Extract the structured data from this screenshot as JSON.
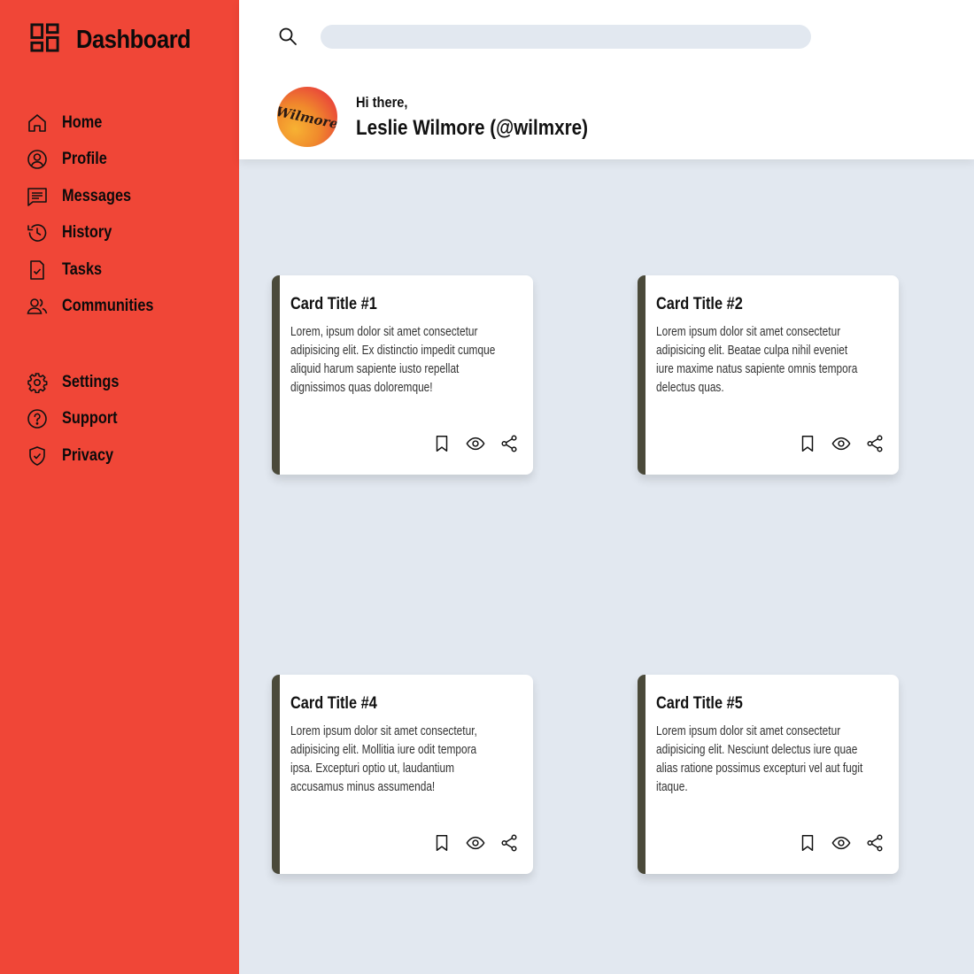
{
  "sidebar": {
    "brand_title": "Dashboard",
    "primary_items": [
      {
        "label": "Home",
        "icon": "home-icon"
      },
      {
        "label": "Profile",
        "icon": "user-circle-icon"
      },
      {
        "label": "Messages",
        "icon": "message-icon"
      },
      {
        "label": "History",
        "icon": "history-icon"
      },
      {
        "label": "Tasks",
        "icon": "task-icon"
      },
      {
        "label": "Communities",
        "icon": "users-icon"
      }
    ],
    "secondary_items": [
      {
        "label": "Settings",
        "icon": "gear-icon"
      },
      {
        "label": "Support",
        "icon": "help-icon"
      },
      {
        "label": "Privacy",
        "icon": "shield-icon"
      }
    ]
  },
  "header": {
    "search_placeholder": "",
    "greeting": "Hi there,",
    "user_name": "Leslie Wilmore (@wilmxre)",
    "avatar_text": "Wilmore"
  },
  "cards": [
    {
      "title": "Card Title #1",
      "text": "Lorem, ipsum dolor sit amet consectetur adipisicing elit. Ex distinctio impedit cumque aliquid harum sapiente iusto repellat dignissimos quas doloremque!"
    },
    {
      "title": "Card Title #2",
      "text": "Lorem ipsum dolor sit amet consectetur adipisicing elit. Beatae culpa nihil eveniet iure maxime natus sapiente omnis tempora delectus quas."
    },
    {
      "title": "Card Title #4",
      "text": "Lorem ipsum dolor sit amet consectetur, adipisicing elit. Mollitia iure odit tempora ipsa. Excepturi optio ut, laudantium accusamus minus assumenda!"
    },
    {
      "title": "Card Title #5",
      "text": "Lorem ipsum dolor sit amet consectetur adipisicing elit. Nesciunt delectus iure quae alias ratione possimus excepturi vel aut fugit itaque."
    }
  ],
  "colors": {
    "sidebar_bg": "#f04637",
    "content_bg": "#e2e8f0",
    "card_accent": "#4b4a3a"
  }
}
